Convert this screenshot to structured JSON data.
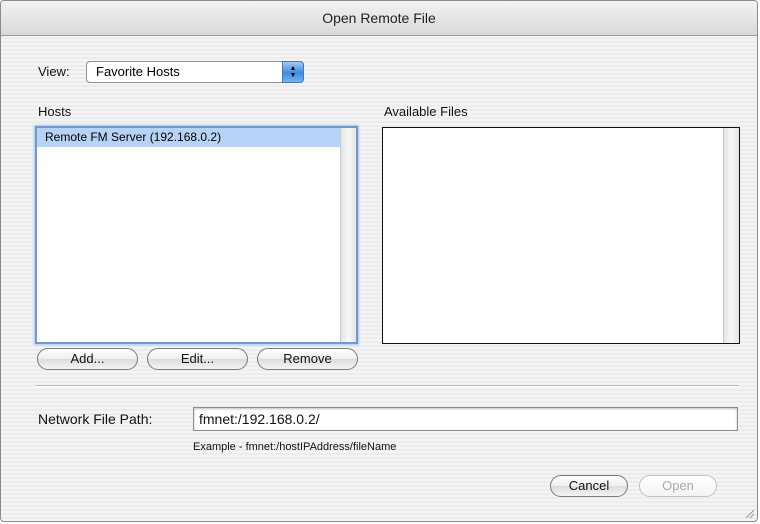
{
  "window": {
    "title": "Open Remote File"
  },
  "view": {
    "label": "View:",
    "selected": "Favorite Hosts"
  },
  "hosts": {
    "header": "Hosts",
    "items": [
      {
        "label": "Remote FM Server (192.168.0.2)",
        "selected": true
      }
    ]
  },
  "files": {
    "header": "Available Files",
    "items": []
  },
  "host_buttons": {
    "add": "Add...",
    "edit": "Edit...",
    "remove": "Remove"
  },
  "path": {
    "label": "Network File Path:",
    "value": "fmnet:/192.168.0.2/",
    "example": "Example - fmnet:/hostIPAddress/fileName"
  },
  "dialog_buttons": {
    "cancel": "Cancel",
    "open": "Open",
    "open_enabled": false
  },
  "colors": {
    "selection": "#b6d3f5",
    "focus_ring": "#6d9ad0",
    "popup_arrow": "#3c8de0"
  }
}
